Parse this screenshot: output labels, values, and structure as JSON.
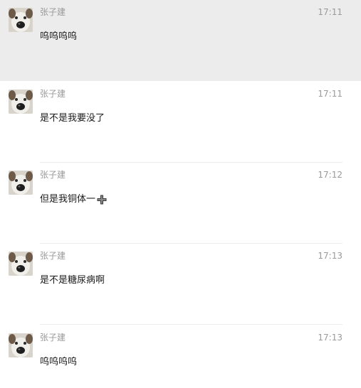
{
  "messages": [
    {
      "sender": "张子建",
      "time": "17:11",
      "text": "呜呜呜呜",
      "avatar_icon": "dog-avatar-icon"
    },
    {
      "sender": "张子建",
      "time": "17:11",
      "text": "是不是我要没了",
      "avatar_icon": "dog-avatar-icon"
    },
    {
      "sender": "张子建",
      "time": "17:12",
      "text": "但是我铜体一",
      "emoji": "cross-emoji-icon",
      "avatar_icon": "dog-avatar-icon"
    },
    {
      "sender": "张子建",
      "time": "17:13",
      "text": "是不是糖尿病啊",
      "avatar_icon": "dog-avatar-icon"
    },
    {
      "sender": "张子建",
      "time": "17:13",
      "text": "呜呜呜呜",
      "avatar_icon": "dog-avatar-icon"
    }
  ],
  "colors": {
    "selected_bg": "#ececec",
    "meta_text": "#9a9a9a",
    "body_text": "#1a1a1a",
    "divider": "#ededed"
  }
}
